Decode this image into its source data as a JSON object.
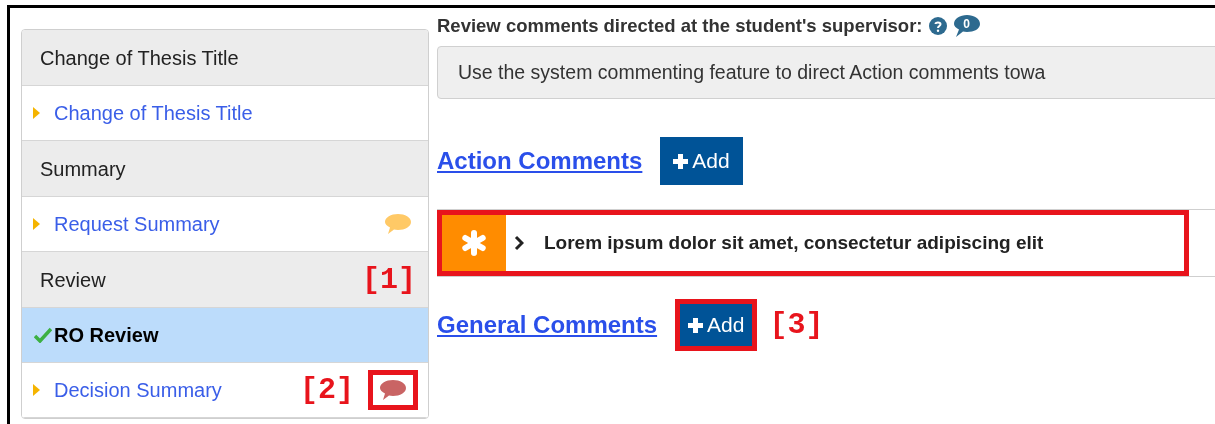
{
  "sidebar": {
    "items": [
      {
        "kind": "header",
        "label": "Change of Thesis Title"
      },
      {
        "kind": "link",
        "label": "Change of Thesis Title"
      },
      {
        "kind": "header",
        "label": "Summary"
      },
      {
        "kind": "link",
        "label": "Request Summary",
        "color": "#ffc966"
      },
      {
        "kind": "header",
        "label": "Review",
        "callout": "[1]"
      },
      {
        "kind": "current",
        "label": "RO Review",
        "completed": true
      },
      {
        "kind": "link",
        "label": "Decision Summary",
        "color": "#c96464",
        "callout": "[2]",
        "highlighted": true
      }
    ]
  },
  "main": {
    "prompt": "Review comments directed at the student's supervisor:",
    "comment_count": "0",
    "note": "Use the system commenting feature to direct Action comments towa",
    "sections": [
      {
        "title": "Action Comments",
        "add_button": {
          "label": "Add",
          "highlighted": false
        },
        "comments": [
          {
            "text": "Lorem ipsum dolor sit amet, consectetur adipiscing elit",
            "highlighted": true
          }
        ]
      },
      {
        "title": "General Comments",
        "add_button": {
          "label": "Add",
          "highlighted": true,
          "callout": "[3]"
        }
      }
    ]
  }
}
